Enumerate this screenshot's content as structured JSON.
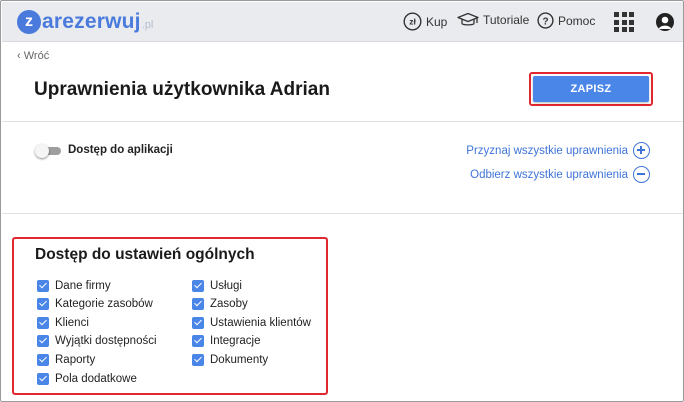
{
  "topbar": {
    "logo": {
      "letter": "z",
      "word": "arezerwuj",
      "tld": ".pl"
    },
    "nav": {
      "kup": {
        "icon": "zl-coin-icon",
        "icon_text": "zł",
        "label": "Kup"
      },
      "tutorials": {
        "icon": "graduation-cap-icon",
        "label": "Tutoriale"
      },
      "help": {
        "icon": "question-circle-icon",
        "icon_text": "?",
        "label": "Pomoc"
      }
    },
    "apps_icon": "apps-grid-icon",
    "avatar_icon": "user-avatar-icon"
  },
  "header": {
    "back_label": "Wróć",
    "title": "Uprawnienia użytkownika Adrian",
    "save_label": "ZAPISZ"
  },
  "access": {
    "toggle_on": false,
    "label": "Dostęp do aplikacji",
    "grant_all": "Przyznaj wszystkie uprawnienia",
    "revoke_all": "Odbierz wszystkie uprawnienia"
  },
  "general_settings": {
    "title": "Dostęp do ustawień ogólnych",
    "left": [
      {
        "label": "Dane firmy",
        "checked": true
      },
      {
        "label": "Kategorie zasobów",
        "checked": true
      },
      {
        "label": "Klienci",
        "checked": true
      },
      {
        "label": "Wyjątki dostępności",
        "checked": true
      },
      {
        "label": "Raporty",
        "checked": true
      },
      {
        "label": "Pola dodatkowe",
        "checked": true
      }
    ],
    "right": [
      {
        "label": "Usługi",
        "checked": true
      },
      {
        "label": "Zasoby",
        "checked": true
      },
      {
        "label": "Ustawienia klientów",
        "checked": true
      },
      {
        "label": "Integracje",
        "checked": true
      },
      {
        "label": "Dokumenty",
        "checked": true
      }
    ]
  },
  "colors": {
    "accent": "#4a86e8",
    "link": "#3f74d8",
    "highlight": "#e0282e",
    "topbar": "#e9ebef"
  }
}
